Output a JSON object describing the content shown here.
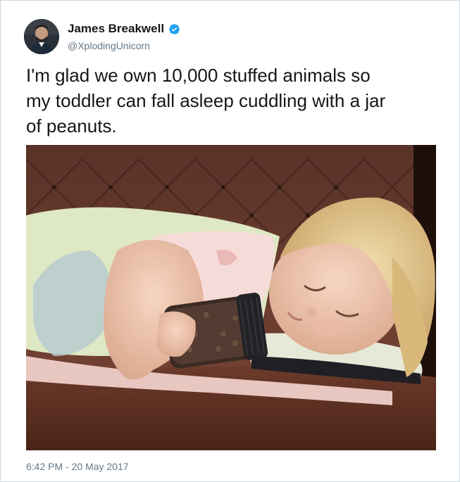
{
  "author": {
    "display_name": "James Breakwell",
    "handle": "@XplodingUnicorn",
    "verified": true
  },
  "tweet": {
    "text": "I'm glad we own 10,000 stuffed animals so\nmy toddler can fall asleep cuddling with a jar\nof peanuts.",
    "timestamp": "6:42 PM - 20 May 2017"
  },
  "media": {
    "description_icon": "photo-attachment"
  },
  "colors": {
    "text_primary": "#14171a",
    "text_secondary": "#657786",
    "verified_blue": "#1da1f2",
    "border": "#cfd9de"
  }
}
